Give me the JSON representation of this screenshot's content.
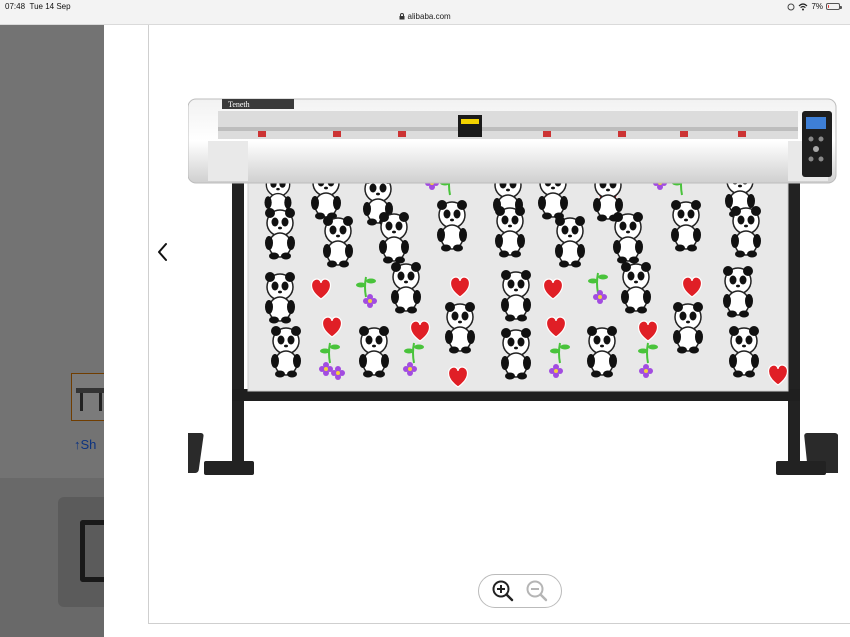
{
  "status_bar": {
    "time": "07:48",
    "date": "Tue 14 Sep",
    "url": "alibaba.com",
    "battery": "7%",
    "battery_level": 0.07,
    "battery_color": "#e03b3b"
  },
  "background_page": {
    "share_label": "↑Sh"
  },
  "viewer": {
    "prev_icon": "chevron-left-icon",
    "zoom_in_icon": "zoom-in-icon",
    "zoom_out_icon": "zoom-out-icon",
    "product_brand_plate": "Teneth",
    "sticker_colors": {
      "heart": "#e01f26",
      "flower": "#a24ce0",
      "leaf": "#49c33b"
    }
  }
}
